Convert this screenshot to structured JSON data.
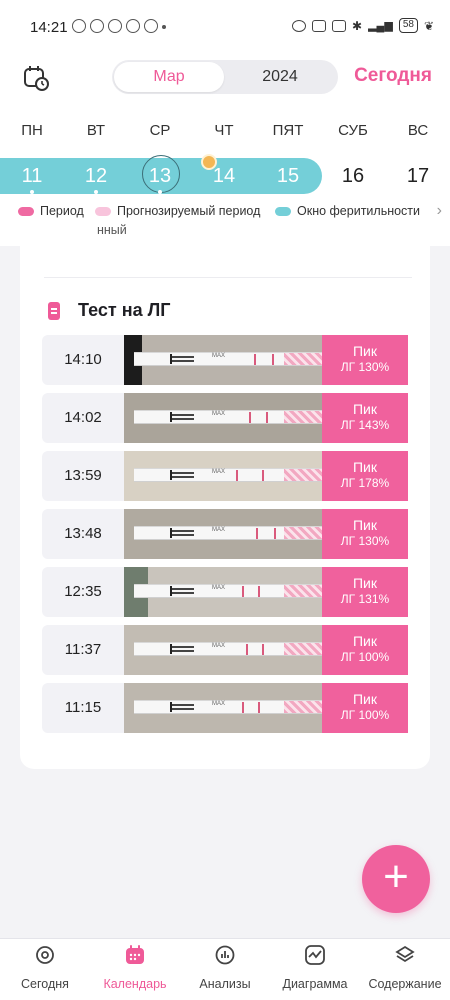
{
  "status_bar": {
    "time": "14:21",
    "battery": "58"
  },
  "header": {
    "month": "Мар",
    "year": "2024",
    "today_label": "Сегодня"
  },
  "weekdays": [
    "ПН",
    "ВТ",
    "СР",
    "ЧТ",
    "ПЯТ",
    "СУБ",
    "ВС"
  ],
  "days": [
    "11",
    "12",
    "13",
    "14",
    "15",
    "16",
    "17"
  ],
  "legend": {
    "period": "Период",
    "predicted_period": "Прогнозируемый период",
    "fertile_window": "Окно феритильности",
    "wrap_text": "нный",
    "colors": {
      "period": "#ef6aa2",
      "predicted_period": "#f8c4dc",
      "fertile_window": "#74cfd8"
    }
  },
  "lh_section": {
    "title": "Тест на ЛГ",
    "results": [
      {
        "time": "14:10",
        "peak": "Пик",
        "lh": "ЛГ 130%"
      },
      {
        "time": "14:02",
        "peak": "Пик",
        "lh": "ЛГ 143%"
      },
      {
        "time": "13:59",
        "peak": "Пик",
        "lh": "ЛГ 178%"
      },
      {
        "time": "13:48",
        "peak": "Пик",
        "lh": "ЛГ 130%"
      },
      {
        "time": "12:35",
        "peak": "Пик",
        "lh": "ЛГ 131%"
      },
      {
        "time": "11:37",
        "peak": "Пик",
        "lh": "ЛГ 100%"
      },
      {
        "time": "11:15",
        "peak": "Пик",
        "lh": "ЛГ 100%"
      }
    ],
    "strip_text": "MAX"
  },
  "fab": {
    "icon": "plus-icon"
  },
  "nav": {
    "items": [
      {
        "label": "Сегодня",
        "icon": "today-icon"
      },
      {
        "label": "Календарь",
        "icon": "calendar-icon"
      },
      {
        "label": "Анализы",
        "icon": "analysis-icon"
      },
      {
        "label": "Диаграмма",
        "icon": "chart-icon"
      },
      {
        "label": "Содержание",
        "icon": "layers-icon"
      }
    ],
    "active_color": "#ef5a98"
  }
}
